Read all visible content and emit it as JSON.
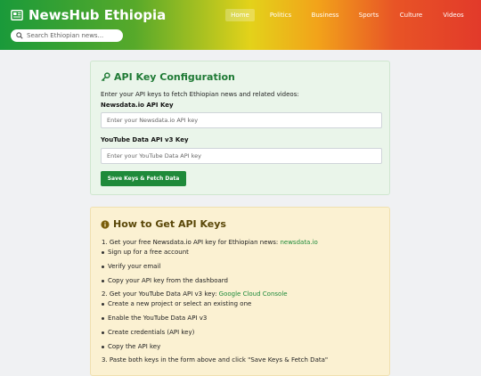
{
  "header": {
    "title": "NewsHub Ethiopia",
    "search_placeholder": "Search Ethiopian news...",
    "nav": [
      {
        "label": "Home",
        "active": true
      },
      {
        "label": "Politics"
      },
      {
        "label": "Business"
      },
      {
        "label": "Sports"
      },
      {
        "label": "Culture"
      },
      {
        "label": "Videos"
      }
    ]
  },
  "api_card": {
    "title": "API Key Configuration",
    "description": "Enter your API keys to fetch Ethiopian news and related videos:",
    "newsdata_label": "Newsdata.io API Key",
    "newsdata_placeholder": "Enter your Newsdata.io API key",
    "youtube_label": "YouTube Data API v3 Key",
    "youtube_placeholder": "Enter your YouTube Data API key",
    "save_button": "Save Keys & Fetch Data"
  },
  "help_card": {
    "title": "How to Get API Keys",
    "step1_text": "1. Get your free Newsdata.io API key for Ethiopian news: ",
    "step1_link": "newsdata.io",
    "step1_items": [
      "Sign up for a free account",
      "Verify your email",
      "Copy your API key from the dashboard"
    ],
    "step2_text": "2. Get your YouTube Data API v3 key: ",
    "step2_link": "Google Cloud Console",
    "step2_items": [
      "Create a new project or select an existing one",
      "Enable the YouTube Data API v3",
      "Create credentials (API key)",
      "Copy the API key"
    ],
    "step3_text": "3. Paste both keys in the form above and click \"Save Keys & Fetch Data\""
  },
  "colors": {
    "accent_green": "#1f8a3a",
    "api_card_bg": "#eaf5ea",
    "help_card_bg": "#fbf1d2"
  },
  "icons": {
    "logo": "newspaper-icon",
    "search": "search-icon",
    "api_title": "key-icon",
    "help_title": "info-circle-icon"
  }
}
